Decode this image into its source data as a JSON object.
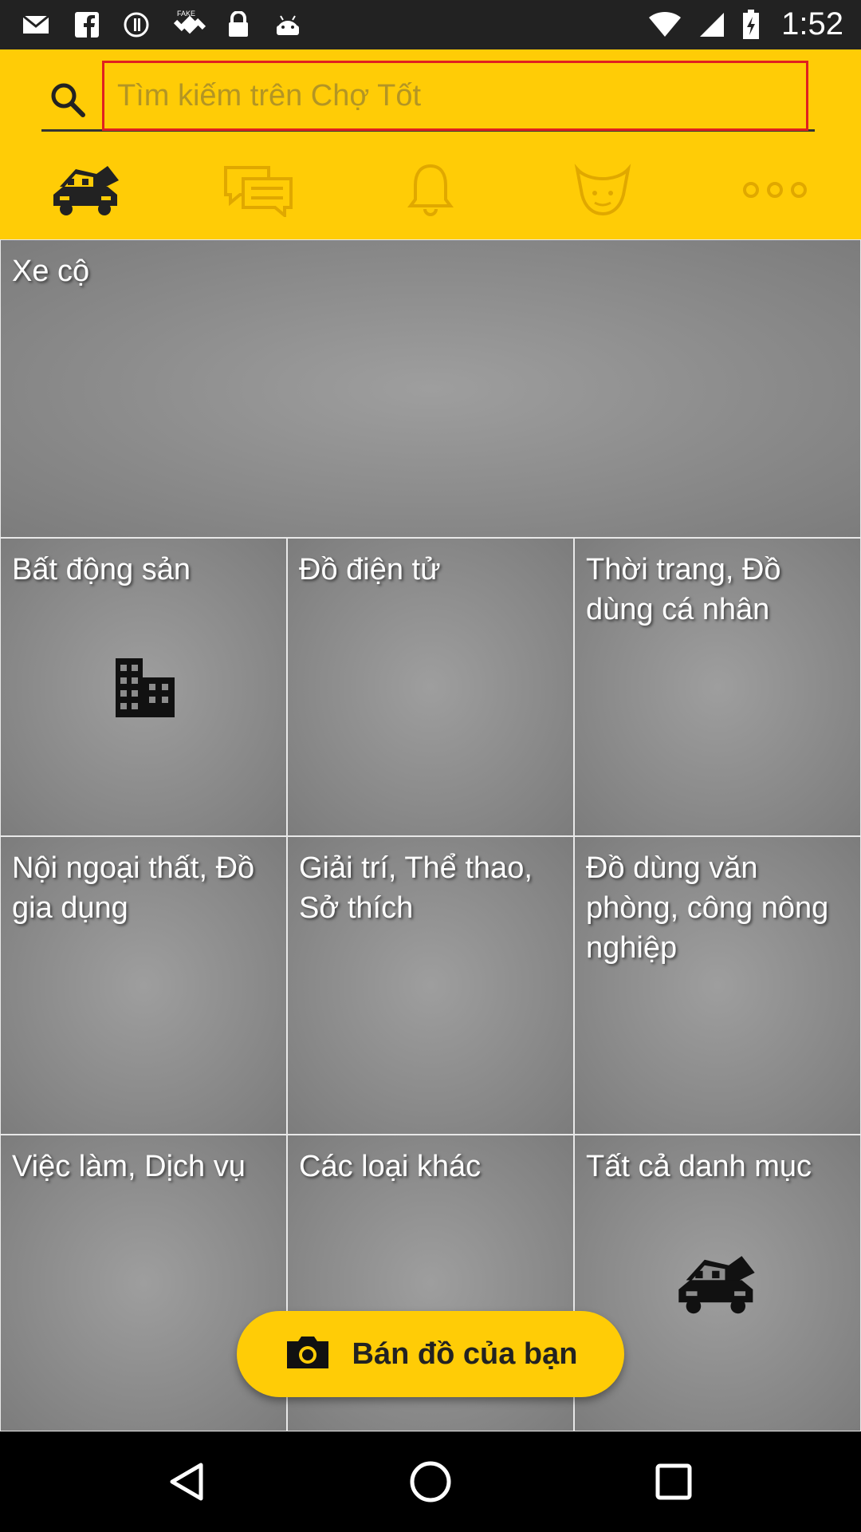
{
  "status_bar": {
    "time": "1:52",
    "left_icons": [
      "gmail-icon",
      "facebook-icon",
      "sync-icon",
      "fake-gps-icon",
      "lock-icon",
      "android-icon"
    ],
    "right_icons": [
      "wifi-icon",
      "signal-icon",
      "battery-icon"
    ]
  },
  "search": {
    "placeholder": "Tìm kiếm trên Chợ Tốt",
    "value": ""
  },
  "nav_tabs": [
    {
      "icon": "car-house-icon",
      "active": true
    },
    {
      "icon": "chat-icon",
      "active": false
    },
    {
      "icon": "bell-icon",
      "active": false
    },
    {
      "icon": "profile-face-icon",
      "active": false
    },
    {
      "icon": "more-dots-icon",
      "active": false
    }
  ],
  "categories": [
    {
      "label": "Xe cộ"
    },
    {
      "label": "Bất động sản",
      "icon": "buildings-icon"
    },
    {
      "label": "Đồ điện tử"
    },
    {
      "label": "Thời trang, Đồ dùng cá nhân"
    },
    {
      "label": "Nội ngoại thất, Đồ gia dụng"
    },
    {
      "label": "Giải trí, Thể thao, Sở thích"
    },
    {
      "label": "Đồ dùng văn phòng, công nông nghiệp"
    },
    {
      "label": "Việc làm, Dịch vụ"
    },
    {
      "label": "Các loại khác"
    },
    {
      "label": "Tất cả danh mục",
      "icon": "car-house-icon"
    }
  ],
  "sell_button": {
    "label": "Bán đồ của bạn",
    "icon": "camera-icon"
  },
  "nav_bar": [
    "back-icon",
    "home-icon",
    "recents-icon"
  ],
  "colors": {
    "accent": "#ffcc06",
    "search_border": "#e02020",
    "tile_gray": "#8c8c8c"
  }
}
